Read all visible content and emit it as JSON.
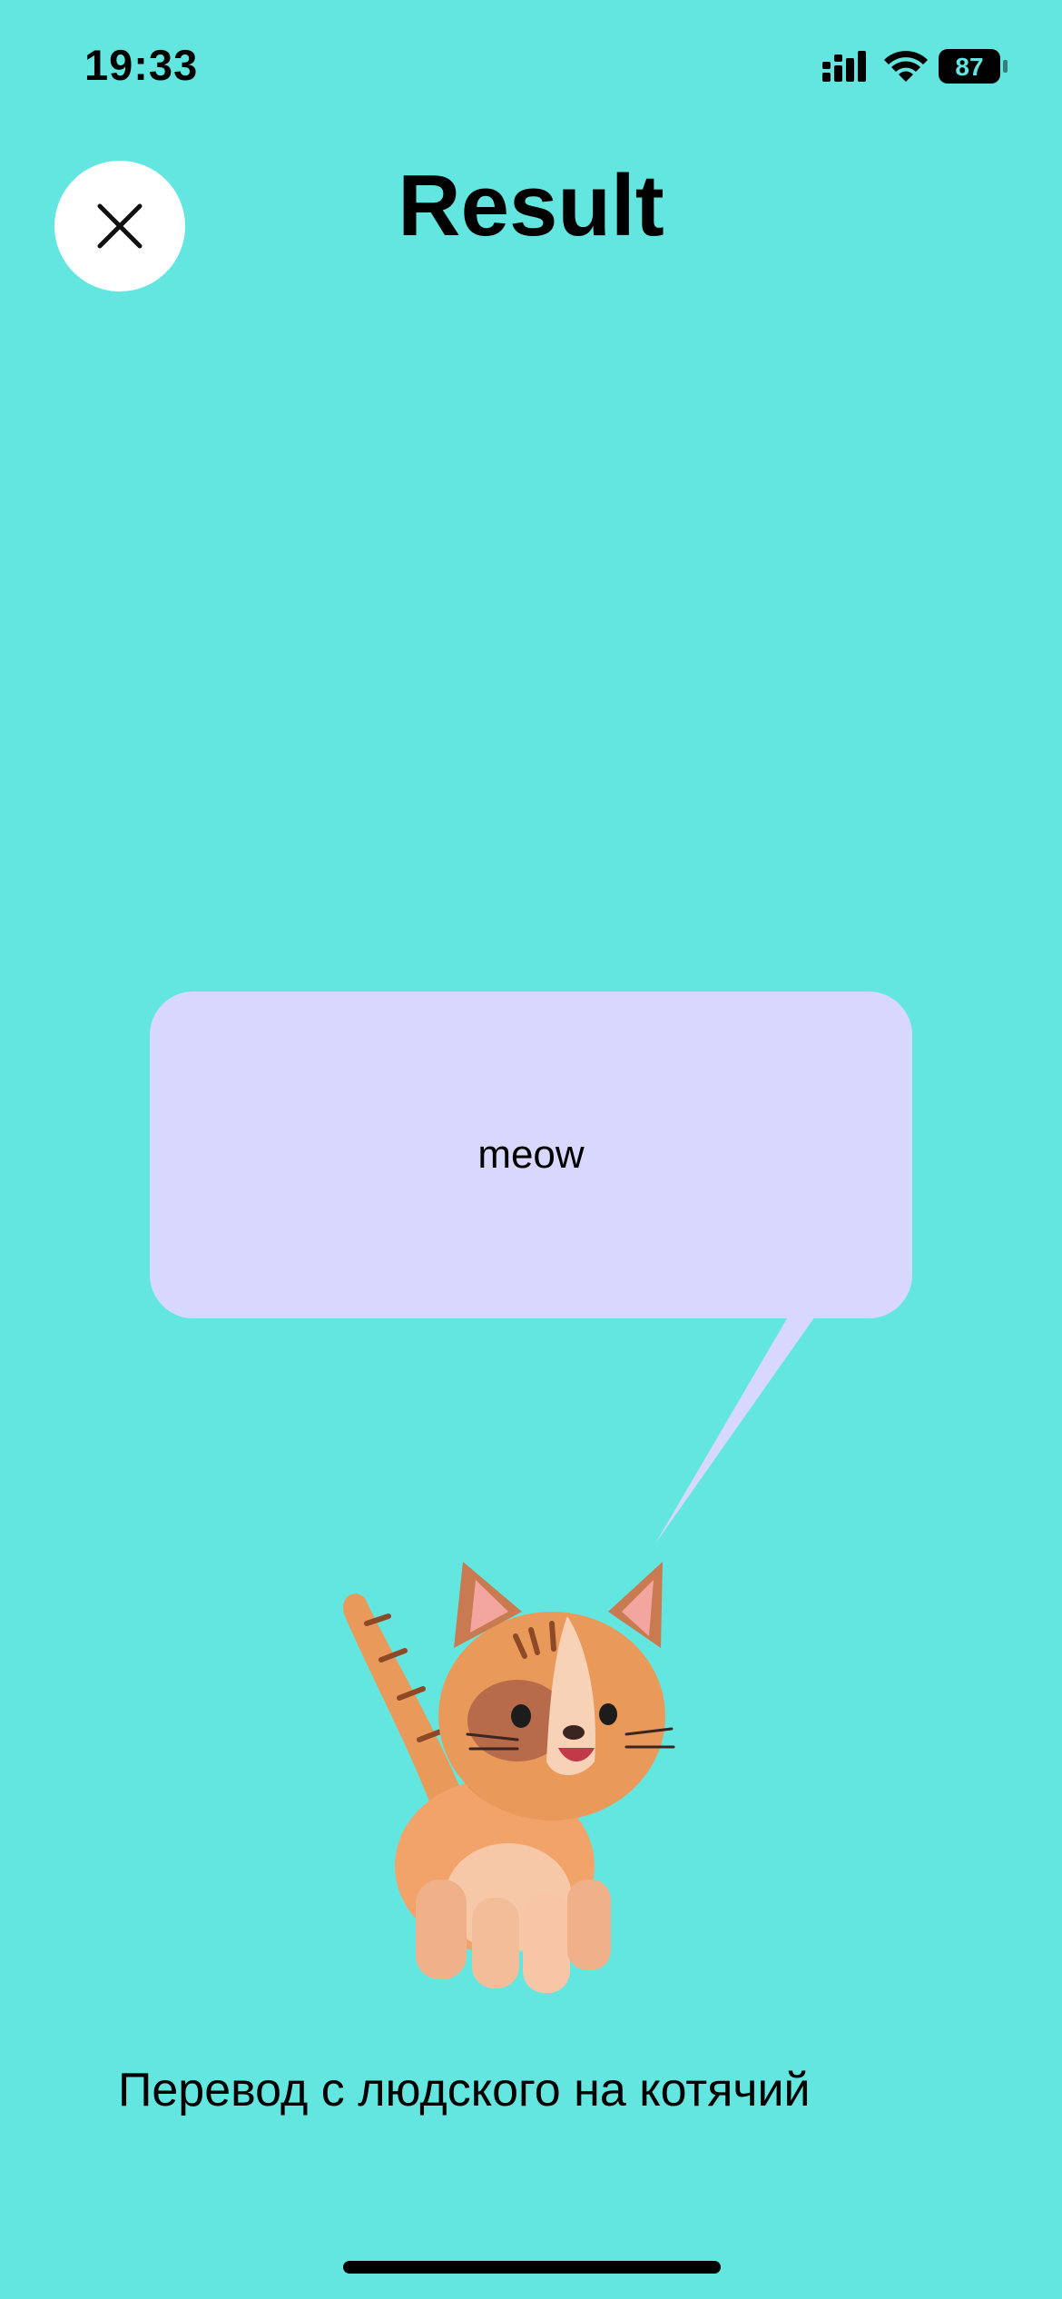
{
  "status_bar": {
    "time": "19:33",
    "battery": "87",
    "icons": [
      "cellular-signal-icon",
      "wifi-icon",
      "battery-icon"
    ]
  },
  "header": {
    "title": "Result",
    "close_icon": "close-icon"
  },
  "speech_bubble": {
    "text": "meow"
  },
  "illustration": {
    "name": "cat-illustration"
  },
  "caption": "Перевод с людского на котячий",
  "colors": {
    "background": "#64E6E0",
    "bubble": "#D8D8FE",
    "close_button": "#FFFFFF"
  }
}
